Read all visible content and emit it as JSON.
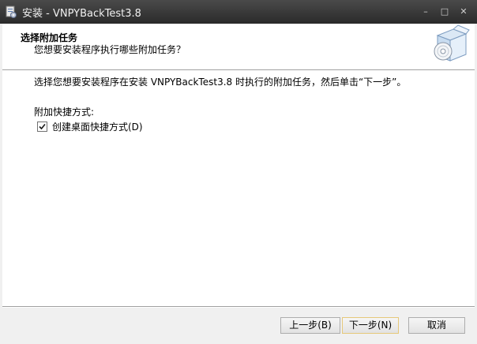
{
  "window": {
    "title": "安装 - VNPYBackTest3.8",
    "minimize_glyph": "–",
    "maximize_glyph": "□",
    "close_glyph": "✕"
  },
  "header": {
    "title": "选择附加任务",
    "subtitle": "您想要安装程序执行哪些附加任务？",
    "icon": "setup-box-cd-icon"
  },
  "main": {
    "description": "选择您想要安装程序在安装 VNPYBackTest3.8 时执行的附加任务，然后单击“下一步”。",
    "group_label": "附加快捷方式:",
    "tasks": [
      {
        "label": "创建桌面快捷方式(D)",
        "checked": true
      }
    ]
  },
  "footer": {
    "back_label": "上一步(B)",
    "next_label": "下一步(N)",
    "cancel_label": "取消"
  }
}
